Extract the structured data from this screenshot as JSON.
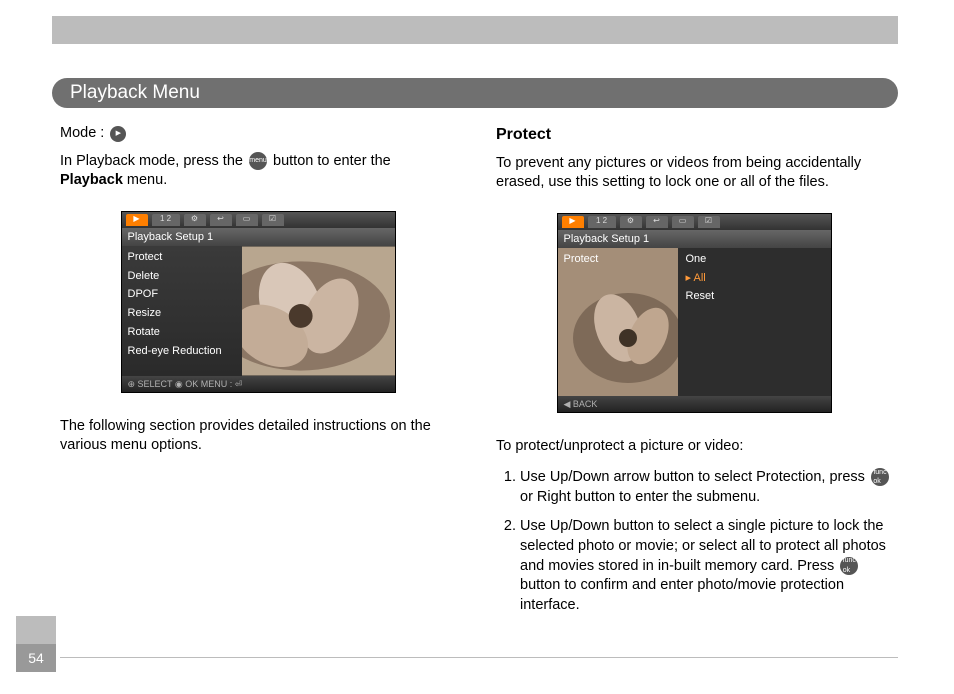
{
  "header": {
    "title": "Playback Menu"
  },
  "left": {
    "mode_label": "Mode :",
    "mode_icon_name": "playback-mode-icon",
    "intro_pre": "In Playback mode, press the ",
    "intro_mid": " button to enter the ",
    "intro_bold": "Playback",
    "intro_post": " menu.",
    "followup": "The following section provides detailed instructions on the various menu options.",
    "screenshot1": {
      "tabs": [
        "▶",
        "1  2",
        "⚙",
        "↩",
        "▭",
        "☑"
      ],
      "title": "Playback Setup 1",
      "items": [
        "Protect",
        "Delete",
        "DPOF",
        "Resize",
        "Rotate",
        "Red-eye Reduction"
      ],
      "footer": "⊕ SELECT   ◉ OK     MENU : ⏎"
    }
  },
  "right": {
    "heading": "Protect",
    "intro": "To prevent any pictures or videos from being accidentally erased, use this setting to lock one or all of the files.",
    "screenshot2": {
      "tabs": [
        "▶",
        "1  2",
        "⚙",
        "↩",
        "▭",
        "☑"
      ],
      "title": "Playback Setup 1",
      "left_label": "Protect",
      "options": [
        "One",
        "All",
        "Reset"
      ],
      "selected_index": 1,
      "footer": "◀ BACK"
    },
    "steps_intro": "To protect/unprotect a picture or video:",
    "step1_a": "Use Up/Down arrow button to select Protection, press ",
    "step1_b": " or Right button to enter the submenu.",
    "step2_a": "Use Up/Down button to select a single picture to lock the selected photo or movie; or select all to protect all photos and movies stored in in-built memory card. Press ",
    "step2_b": " button to confirm and enter photo/movie protection interface."
  },
  "page_number": "54"
}
